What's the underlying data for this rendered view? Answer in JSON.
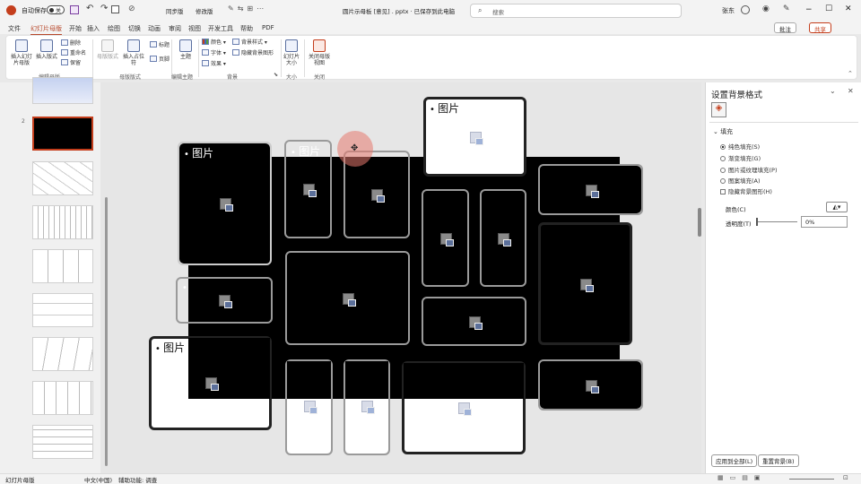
{
  "titlebar": {
    "autosave": "自动保存",
    "toggle": "关",
    "toolbar_items": [
      "同步版",
      "修改版"
    ],
    "filename": "圆片示母板 [意见] . pptx · 已保存到此电脑",
    "search_placeholder": "搜索",
    "user": "张东",
    "color_accent": "#c43e1c"
  },
  "menu_tabs": [
    "文件",
    "幻灯片母版",
    "开始",
    "插入",
    "绘图",
    "切换",
    "动画",
    "审阅",
    "视图",
    "开发工具",
    "帮助",
    "PDF"
  ],
  "active_tab": "幻灯片母版",
  "right_buttons": {
    "comment": "批注",
    "share": "共享"
  },
  "ribbon": {
    "groups": [
      {
        "label": "编辑母版",
        "buttons": [
          "插入幻灯片母版",
          "插入版式"
        ],
        "small": [
          "删除",
          "重命名",
          "保留"
        ]
      },
      {
        "label": "母版版式",
        "buttons": [
          "母版版式",
          "插入占位符"
        ],
        "small": [
          "标题",
          "页脚"
        ]
      },
      {
        "label": "编辑主题",
        "buttons": [
          "主题"
        ],
        "small": []
      },
      {
        "label": "背景",
        "buttons": [],
        "small": [
          "颜色",
          "字体",
          "效果",
          "背景样式",
          "隐藏背景图形"
        ]
      },
      {
        "label": "大小",
        "buttons": [
          "幻灯片大小"
        ],
        "small": []
      },
      {
        "label": "关闭",
        "buttons": [
          "关闭母版视图"
        ],
        "small": []
      }
    ]
  },
  "thumbnails": {
    "numbers": [
      "",
      "2",
      "",
      "",
      "",
      "",
      "",
      "",
      ""
    ]
  },
  "slide": {
    "placeholder_label": "图片"
  },
  "format_pane": {
    "title": "设置背景格式",
    "section": "填充",
    "options": [
      "纯色填充(S)",
      "渐变填充(G)",
      "图片或纹理填充(P)",
      "图案填充(A)",
      "隐藏背景图形(H)"
    ],
    "selected_option": "纯色填充(S)",
    "color_label": "颜色(C)",
    "transparency_label": "透明度(T)",
    "transparency_value": "0%",
    "apply_all": "应用到全部(L)",
    "reset": "重置背景(B)"
  },
  "statusbar": {
    "left": "幻灯片母版",
    "lang": "中文(中国)",
    "accessibility": "辅助功能: 调查"
  }
}
